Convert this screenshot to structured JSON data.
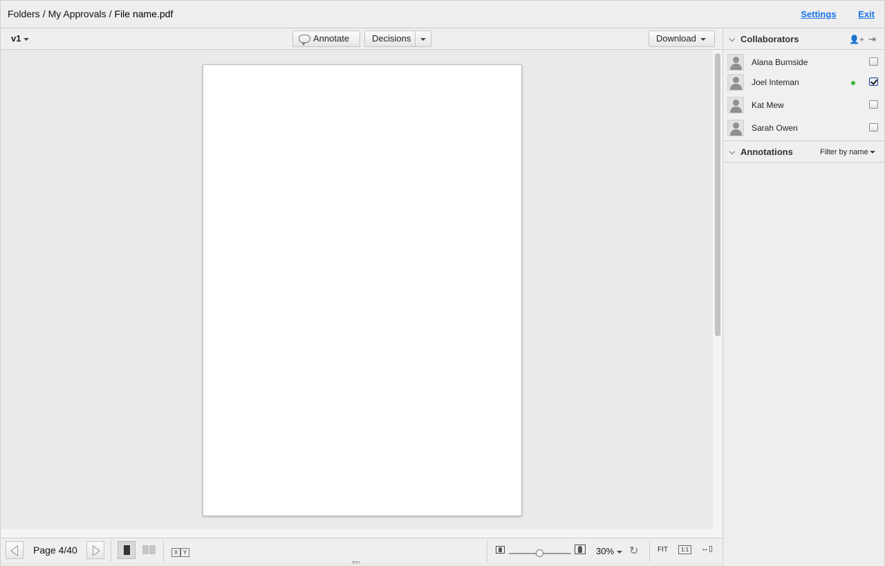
{
  "header": {
    "breadcrumb": [
      "Folders",
      "My Approvals",
      "File name.pdf"
    ],
    "separator": "/",
    "settings_label": "Settings",
    "exit_label": "Exit"
  },
  "toolbar": {
    "version": "v1",
    "annotate_label": "Annotate",
    "decisions_label": "Decisions",
    "download_label": "Download"
  },
  "footer": {
    "page_label": "Page 4/40",
    "x_label": "X",
    "y_label": "Y",
    "zoom_value": "30%",
    "fit_label": "FIT",
    "one_to_one_label": "1:1"
  },
  "colors": {
    "link": "#1a73e8",
    "online": "#3ab53a"
  },
  "collaborators": {
    "title": "Collaborators",
    "people": [
      {
        "name": "Alana Burnside",
        "online": false,
        "checked": false
      },
      {
        "name": "Joel Inteman",
        "online": true,
        "checked": true
      },
      {
        "name": "Kat Mew",
        "online": false,
        "checked": false
      },
      {
        "name": "Sarah Owen",
        "online": false,
        "checked": false
      }
    ]
  },
  "annotations": {
    "title": "Annotations",
    "filter_label": "Filter by name"
  }
}
